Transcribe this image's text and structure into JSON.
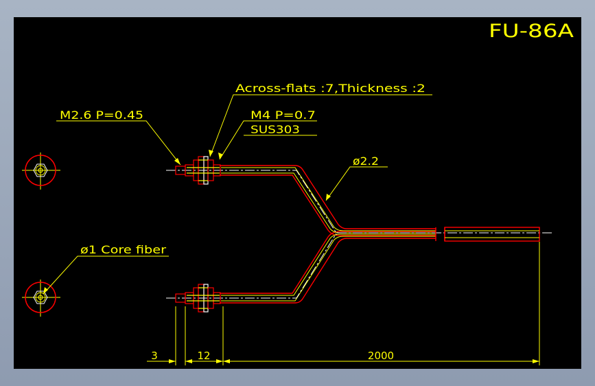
{
  "drawing": {
    "title": "FU-86A",
    "annotations": {
      "across_flats": "Across-flats :7,Thickness :2",
      "thread_small": "M2.6 P=0.45",
      "thread_large": "M4 P=0.7",
      "material": "SUS303",
      "diameter": "ø2.2",
      "core_fiber": "ø1 Core fiber"
    },
    "dimensions": {
      "dim_a": "3",
      "dim_b": "12",
      "dim_c": "2000"
    },
    "colors": {
      "background": "#000000",
      "text": "#ffff00",
      "outline": "#ff0000",
      "centerline": "#ffffff",
      "frame": "#a8b4c4"
    }
  }
}
